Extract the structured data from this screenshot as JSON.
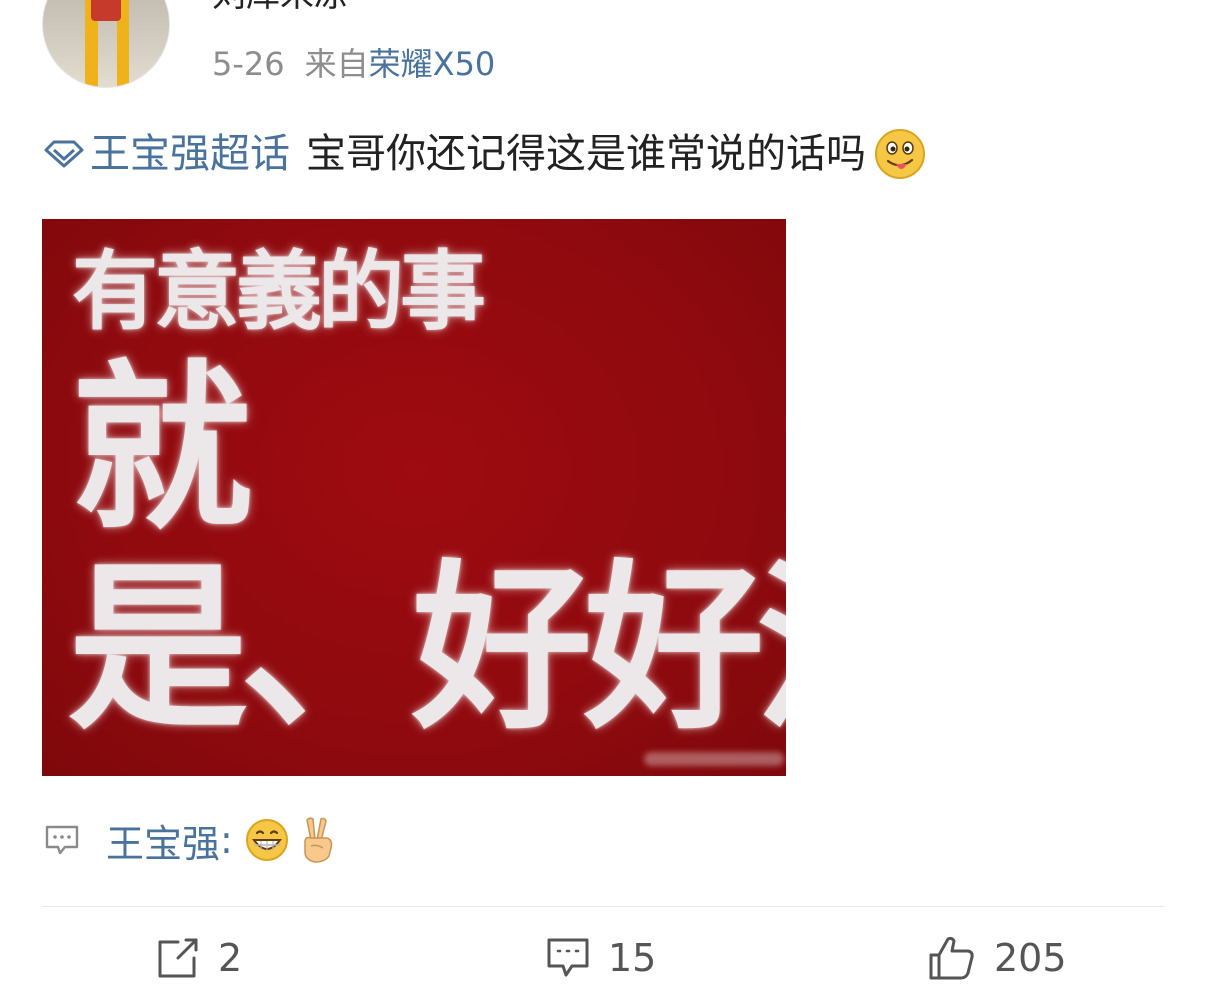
{
  "post": {
    "username": "刘库米凉",
    "date": "5-26",
    "source_prefix": "来自",
    "device": "荣耀X50",
    "topic": "王宝强超话",
    "text": "宝哥你还记得这是谁常说的话吗",
    "text_emoji": "tongue-out-face-icon"
  },
  "image": {
    "line1": "有意義的事",
    "line2": "就",
    "line3": "是、好好活",
    "background_color": "#8f0a0e"
  },
  "comment_preview": {
    "commenter": "王宝强",
    "colon": ":",
    "emojis": [
      "grin-face-icon",
      "victory-hand-icon"
    ]
  },
  "actions": {
    "repost_count": "2",
    "comment_count": "15",
    "like_count": "205"
  },
  "colors": {
    "link": "#49739c",
    "meta": "#8d8d8d",
    "text": "#222222"
  }
}
